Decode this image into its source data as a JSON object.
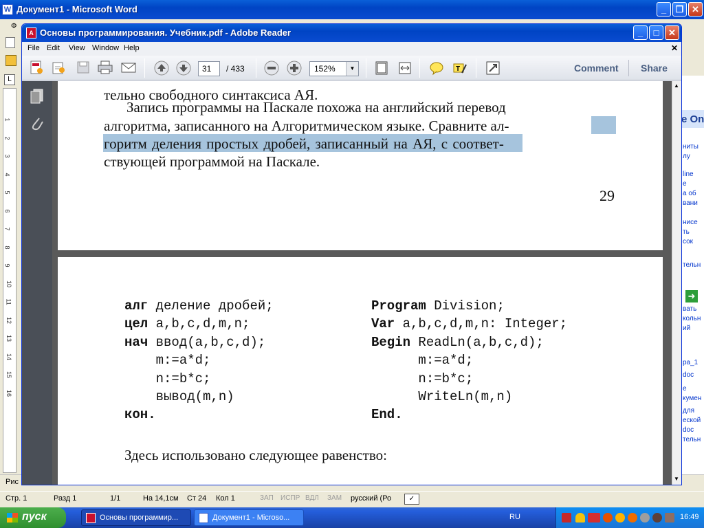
{
  "word": {
    "title": "Документ1 - Microsoft Word",
    "menu_first": "Ф",
    "side_panel": {
      "heading": "e On",
      "lines": [
        "ниты",
        "лу",
        "line",
        "е",
        "а об",
        "вани",
        "нисе",
        "ть",
        "сок",
        "тельн",
        "вать",
        "кольн",
        "ий",
        "ра_1",
        "doc",
        "е",
        "кумен",
        "для",
        "еской",
        "doc",
        "тельн"
      ]
    },
    "drawing_label": "Рис",
    "status": {
      "page": "Стр. 1",
      "section": "Разд 1",
      "pages": "1/1",
      "at": "На 14,1см",
      "line": "Ст 24",
      "col": "Кол 1",
      "rec": "ЗАП",
      "trk": "ИСПР",
      "ext": "ВДЛ",
      "ovr": "ЗАМ",
      "lang": "русский (Ро"
    },
    "ruler_numbers": [
      "1",
      "2",
      "3",
      "4",
      "5",
      "6",
      "7",
      "8",
      "9",
      "10",
      "11",
      "12",
      "13",
      "14",
      "15",
      "16"
    ]
  },
  "reader": {
    "title": "Основы программирования. Учебник.pdf - Adobe Reader",
    "menu": [
      "File",
      "Edit",
      "View",
      "Window",
      "Help"
    ],
    "page_current": "31",
    "page_total": "/ 433",
    "zoom": "152%",
    "comment_label": "Comment",
    "share_label": "Share"
  },
  "pdf": {
    "top_lines": [
      "тельно свободного синтаксиса АЯ."
    ],
    "para": [
      "Запись программы на Паскале похожа на английский перевод",
      "алгоритма, записанного на Алгоритмическом языке. Сравните ал-",
      "горитм деления простых дробей, записанный на АЯ, с соответ-",
      "ствующей программой на Паскале."
    ],
    "page_number": "29",
    "left_code": [
      {
        "kw": "алг",
        "rest": " деление дробей;"
      },
      {
        "kw": "цел",
        "rest": " a,b,c,d,m,n;"
      },
      {
        "kw": "нач",
        "rest": " ввод(a,b,c,d);"
      },
      {
        "kw": "",
        "rest": "    m:=a*d;"
      },
      {
        "kw": "",
        "rest": "    n:=b*c;"
      },
      {
        "kw": "",
        "rest": "    вывод(m,n)"
      },
      {
        "kw": "кон.",
        "rest": ""
      }
    ],
    "right_code": [
      {
        "kw": "Program",
        "rest": " Division;"
      },
      {
        "kw": "Var",
        "rest": " a,b,c,d,m,n: Integer;"
      },
      {
        "kw": "Begin",
        "rest": " ReadLn(a,b,c,d);"
      },
      {
        "kw": "",
        "rest": "      m:=a*d;"
      },
      {
        "kw": "",
        "rest": "      n:=b*c;"
      },
      {
        "kw": "",
        "rest": "      WriteLn(m,n)"
      },
      {
        "kw": "End.",
        "rest": ""
      }
    ],
    "bottom_line": "Здесь использовано следующее равенство:"
  },
  "taskbar": {
    "start_label": "пуск",
    "tasks": [
      "Основы программир...",
      "Документ1 - Microso..."
    ],
    "lang": "RU",
    "time": "16:49"
  }
}
